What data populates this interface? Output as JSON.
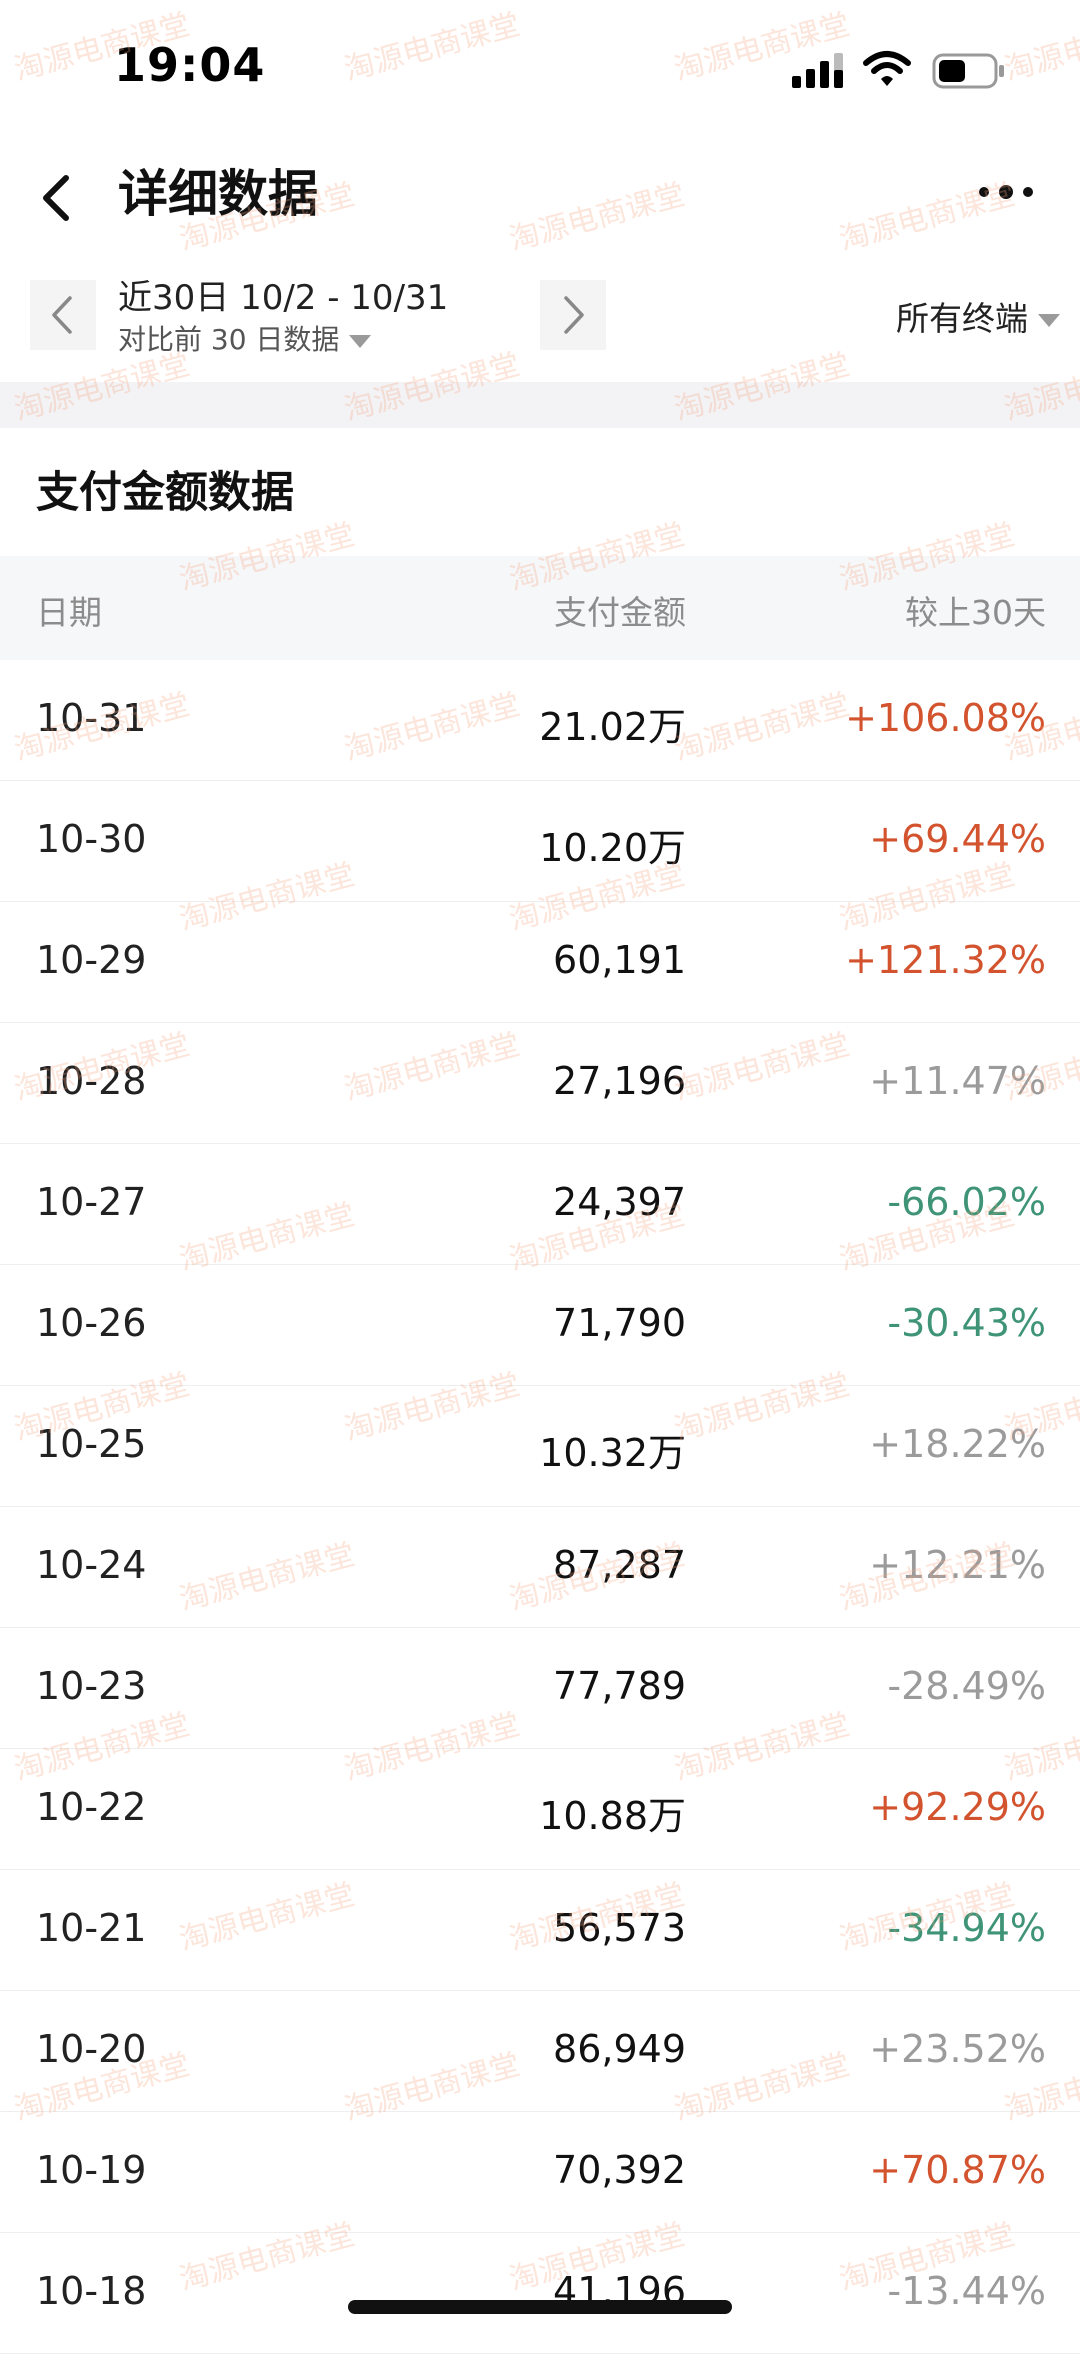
{
  "status_bar": {
    "time": "19:04"
  },
  "header": {
    "title": "详细数据"
  },
  "date_selector": {
    "range_label": "近30日 10/2 - 10/31",
    "compare_label": "对比前 30 日数据",
    "terminal_label": "所有终端"
  },
  "section": {
    "title": "支付金额数据"
  },
  "table": {
    "columns": [
      "日期",
      "支付金额",
      "较上30天"
    ],
    "rows": [
      {
        "date": "10-31",
        "amount": "21.02万",
        "change": "+106.08%",
        "trend": "up"
      },
      {
        "date": "10-30",
        "amount": "10.20万",
        "change": "+69.44%",
        "trend": "up"
      },
      {
        "date": "10-29",
        "amount": "60,191",
        "change": "+121.32%",
        "trend": "up"
      },
      {
        "date": "10-28",
        "amount": "27,196",
        "change": "+11.47%",
        "trend": "neutral"
      },
      {
        "date": "10-27",
        "amount": "24,397",
        "change": "-66.02%",
        "trend": "down"
      },
      {
        "date": "10-26",
        "amount": "71,790",
        "change": "-30.43%",
        "trend": "down"
      },
      {
        "date": "10-25",
        "amount": "10.32万",
        "change": "+18.22%",
        "trend": "neutral"
      },
      {
        "date": "10-24",
        "amount": "87,287",
        "change": "+12.21%",
        "trend": "neutral"
      },
      {
        "date": "10-23",
        "amount": "77,789",
        "change": "-28.49%",
        "trend": "neutral"
      },
      {
        "date": "10-22",
        "amount": "10.88万",
        "change": "+92.29%",
        "trend": "up"
      },
      {
        "date": "10-21",
        "amount": "56,573",
        "change": "-34.94%",
        "trend": "down"
      },
      {
        "date": "10-20",
        "amount": "86,949",
        "change": "+23.52%",
        "trend": "neutral"
      },
      {
        "date": "10-19",
        "amount": "70,392",
        "change": "+70.87%",
        "trend": "up"
      },
      {
        "date": "10-18",
        "amount": "41,196",
        "change": "-13.44%",
        "trend": "neutral"
      }
    ]
  },
  "watermark": {
    "text": "淘源电商课堂"
  },
  "colors": {
    "up": "#d2532e",
    "down": "#3f9478",
    "neutral": "#9b9b9b"
  }
}
